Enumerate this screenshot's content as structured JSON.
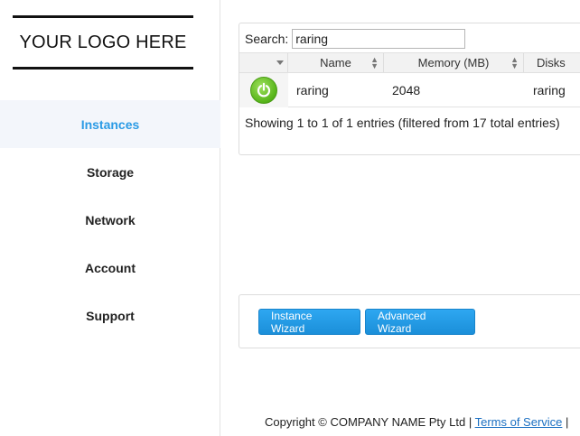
{
  "logo": {
    "text": "YOUR LOGO HERE"
  },
  "nav": {
    "items": [
      {
        "label": "Instances",
        "active": true
      },
      {
        "label": "Storage"
      },
      {
        "label": "Network"
      },
      {
        "label": "Account"
      },
      {
        "label": "Support"
      }
    ]
  },
  "search": {
    "label": "Search:",
    "value": "raring"
  },
  "table": {
    "columns": [
      "",
      "Name",
      "Memory (MB)",
      "Disks"
    ],
    "rows": [
      {
        "status_icon": "power-icon",
        "status_color": "#56b419",
        "name": "raring",
        "memory": "2048",
        "disks": "raring"
      }
    ],
    "info": "Showing 1 to 1 of 1 entries (filtered from 17 total entries)"
  },
  "wizards": {
    "instance_wizard": "Instance Wizard",
    "advanced_wizard": "Advanced Wizard"
  },
  "footer": {
    "copyright": "Copyright © COMPANY NAME Pty Ltd | ",
    "terms": "Terms of Service",
    "separator": " |"
  },
  "colors": {
    "accent": "#2b9be5",
    "button": "#1b8fd9"
  }
}
